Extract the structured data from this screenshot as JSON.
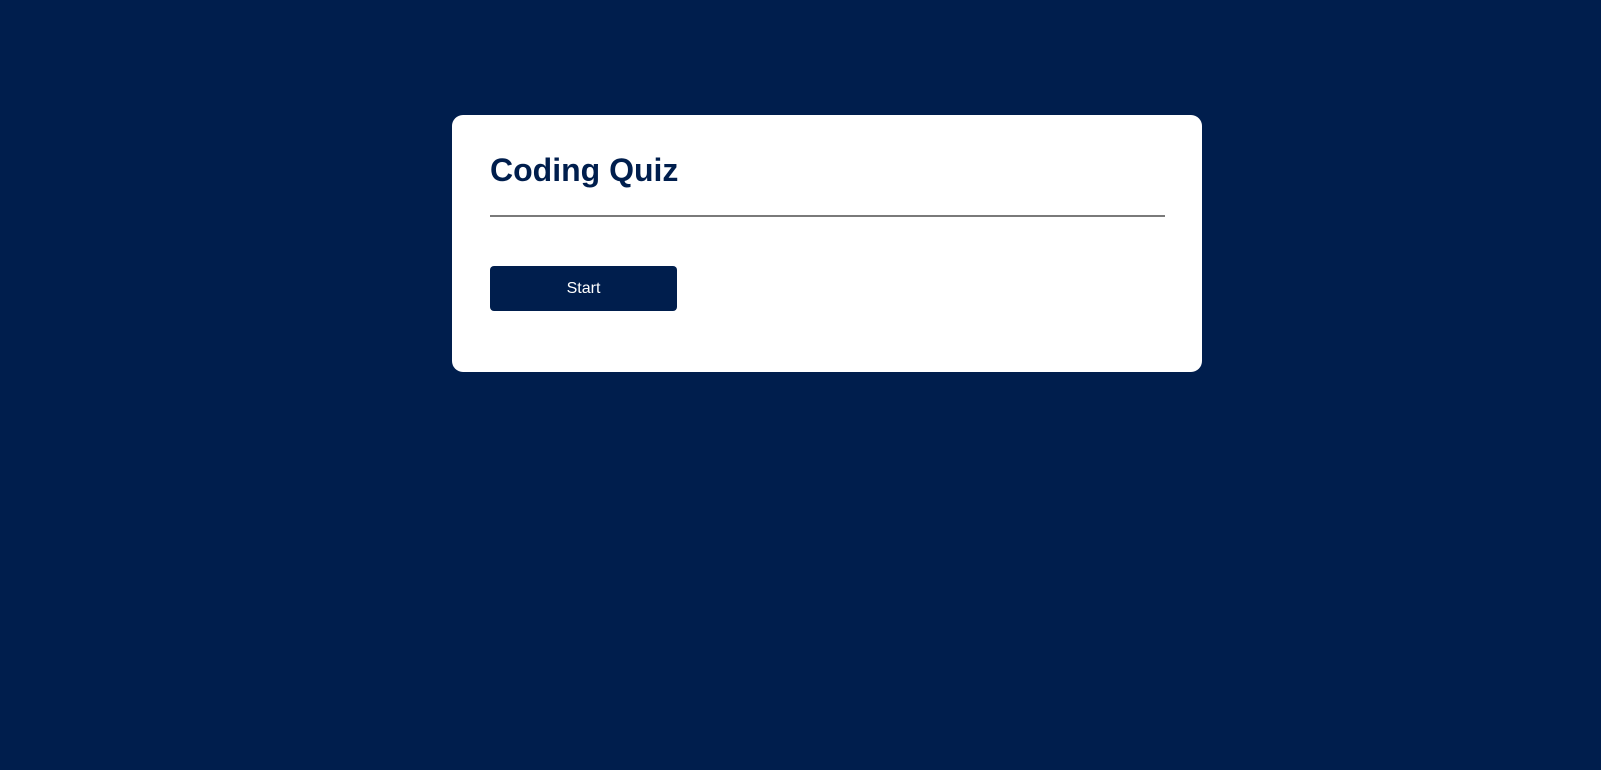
{
  "quiz": {
    "title": "Coding Quiz",
    "start_label": "Start"
  },
  "colors": {
    "background": "#001e4d",
    "card": "#ffffff",
    "button": "#001e4d",
    "button_text": "#ffffff",
    "divider": "#7a7a7a"
  }
}
